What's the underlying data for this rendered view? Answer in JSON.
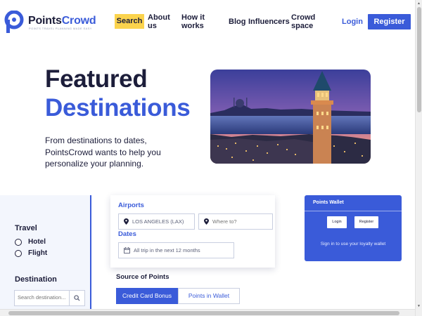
{
  "brand": {
    "name_part1": "Points",
    "name_part2": "Crowd",
    "tagline": "POINTS TRAVEL PLANNING MADE EASY",
    "logo_icon": "pointscrowd-logo-icon"
  },
  "nav": {
    "search": "Search",
    "about_line1": "About",
    "about_line2": "us",
    "how_line1": "How it",
    "how_line2": "works",
    "blog": "Blog",
    "influencers": "Influencers",
    "crowd_line1": "Crowd",
    "crowd_line2": "space",
    "login": "Login",
    "register": "Register"
  },
  "hero": {
    "title_line1": "Featured",
    "title_line2": "Destinations",
    "subtitle": "From destinations to dates, PointsCrowd wants to help you personalize your planning.",
    "image": "istanbul-galata-tower-night-skyline"
  },
  "filters": {
    "travel_label": "Travel",
    "options": [
      "Hotel",
      "Flight"
    ],
    "destination_label": "Destination",
    "destination_placeholder": "Search destination..."
  },
  "search_card": {
    "airports_label": "Airports",
    "from_value": "LOS ANGELES (LAX)",
    "to_placeholder": "Where to?",
    "dates_label": "Dates",
    "dates_value": "All trip in the next 12 months"
  },
  "source": {
    "label": "Source of Points",
    "tab_active": "Credit Card Bonus",
    "tab_inactive": "Points in Wallet"
  },
  "wallet": {
    "title": "Points Wallet",
    "login": "Login",
    "register": "Register",
    "note": "Sign in to use your loyalty wallet"
  },
  "colors": {
    "accent": "#3a5bd9",
    "highlight": "#fbd34d",
    "text": "#1c1d3a"
  }
}
